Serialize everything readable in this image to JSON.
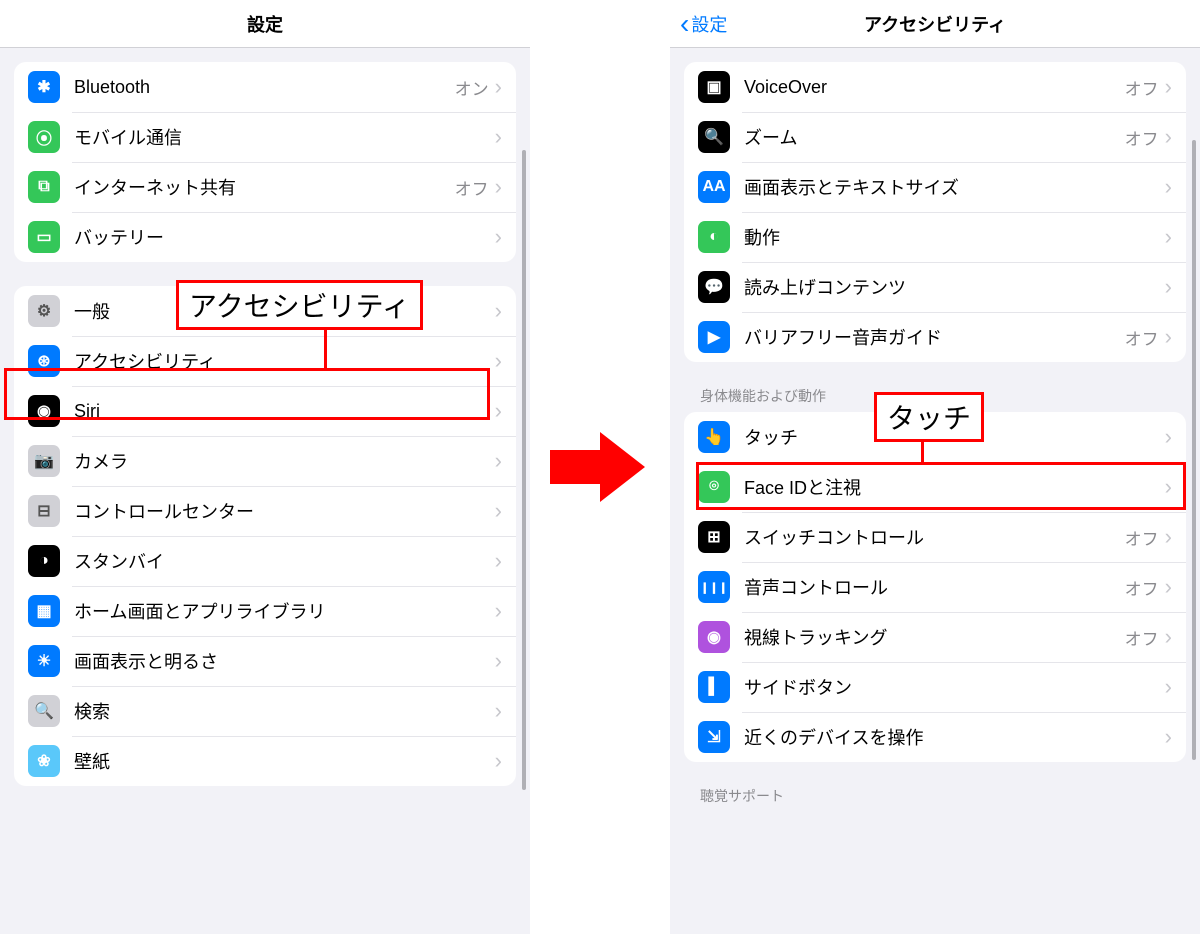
{
  "left": {
    "title": "設定",
    "group1": [
      {
        "name": "bluetooth",
        "label": "Bluetooth",
        "value": "オン",
        "iconBg": "bg-blue",
        "glyph": "✱"
      },
      {
        "name": "cellular",
        "label": "モバイル通信",
        "value": "",
        "iconBg": "bg-green",
        "glyph": "⦿"
      },
      {
        "name": "hotspot",
        "label": "インターネット共有",
        "value": "オフ",
        "iconBg": "bg-green",
        "glyph": "⧉"
      },
      {
        "name": "battery",
        "label": "バッテリー",
        "value": "",
        "iconBg": "bg-green",
        "glyph": "▭"
      }
    ],
    "group2": [
      {
        "name": "general",
        "label": "一般",
        "value": "",
        "iconBg": "bg-litegray",
        "glyph": "⚙"
      },
      {
        "name": "accessibility",
        "label": "アクセシビリティ",
        "value": "",
        "iconBg": "bg-blue",
        "glyph": "⊛"
      },
      {
        "name": "siri",
        "label": "Siri",
        "value": "",
        "iconBg": "bg-black",
        "glyph": "◉"
      },
      {
        "name": "camera",
        "label": "カメラ",
        "value": "",
        "iconBg": "bg-litegray",
        "glyph": "📷"
      },
      {
        "name": "control-center",
        "label": "コントロールセンター",
        "value": "",
        "iconBg": "bg-litegray",
        "glyph": "⊟"
      },
      {
        "name": "standby",
        "label": "スタンバイ",
        "value": "",
        "iconBg": "bg-black",
        "glyph": "◑"
      },
      {
        "name": "home-screen",
        "label": "ホーム画面とアプリライブラリ",
        "value": "",
        "iconBg": "bg-blue",
        "glyph": "▦"
      },
      {
        "name": "display",
        "label": "画面表示と明るさ",
        "value": "",
        "iconBg": "bg-blue",
        "glyph": "☀"
      },
      {
        "name": "search",
        "label": "検索",
        "value": "",
        "iconBg": "bg-litegray",
        "glyph": "🔍"
      },
      {
        "name": "wallpaper",
        "label": "壁紙",
        "value": "",
        "iconBg": "bg-cyan",
        "glyph": "❀"
      }
    ],
    "callout": "アクセシビリティ"
  },
  "right": {
    "backLabel": "設定",
    "title": "アクセシビリティ",
    "group1": [
      {
        "name": "voiceover",
        "label": "VoiceOver",
        "value": "オフ",
        "iconBg": "bg-black",
        "glyph": "▣"
      },
      {
        "name": "zoom",
        "label": "ズーム",
        "value": "オフ",
        "iconBg": "bg-black",
        "glyph": "🔍"
      },
      {
        "name": "display-text",
        "label": "画面表示とテキストサイズ",
        "value": "",
        "iconBg": "bg-blue",
        "glyph": "AA"
      },
      {
        "name": "motion",
        "label": "動作",
        "value": "",
        "iconBg": "bg-green",
        "glyph": "◐"
      },
      {
        "name": "spoken-content",
        "label": "読み上げコンテンツ",
        "value": "",
        "iconBg": "bg-black",
        "glyph": "💬"
      },
      {
        "name": "audio-descriptions",
        "label": "バリアフリー音声ガイド",
        "value": "オフ",
        "iconBg": "bg-blue",
        "glyph": "▶"
      }
    ],
    "section2Header": "身体機能および動作",
    "group2": [
      {
        "name": "touch",
        "label": "タッチ",
        "value": "",
        "iconBg": "bg-blue",
        "glyph": "👆"
      },
      {
        "name": "face-id",
        "label": "Face IDと注視",
        "value": "",
        "iconBg": "bg-green",
        "glyph": "⌾"
      },
      {
        "name": "switch-control",
        "label": "スイッチコントロール",
        "value": "オフ",
        "iconBg": "bg-black",
        "glyph": "⊞"
      },
      {
        "name": "voice-control",
        "label": "音声コントロール",
        "value": "オフ",
        "iconBg": "bg-blue",
        "glyph": "❙❙❙"
      },
      {
        "name": "eye-tracking",
        "label": "視線トラッキング",
        "value": "オフ",
        "iconBg": "bg-purple",
        "glyph": "◉"
      },
      {
        "name": "side-button",
        "label": "サイドボタン",
        "value": "",
        "iconBg": "bg-blue",
        "glyph": "▌"
      },
      {
        "name": "nearby-devices",
        "label": "近くのデバイスを操作",
        "value": "",
        "iconBg": "bg-blue",
        "glyph": "⇲"
      }
    ],
    "section3Header": "聴覚サポート",
    "callout": "タッチ"
  }
}
